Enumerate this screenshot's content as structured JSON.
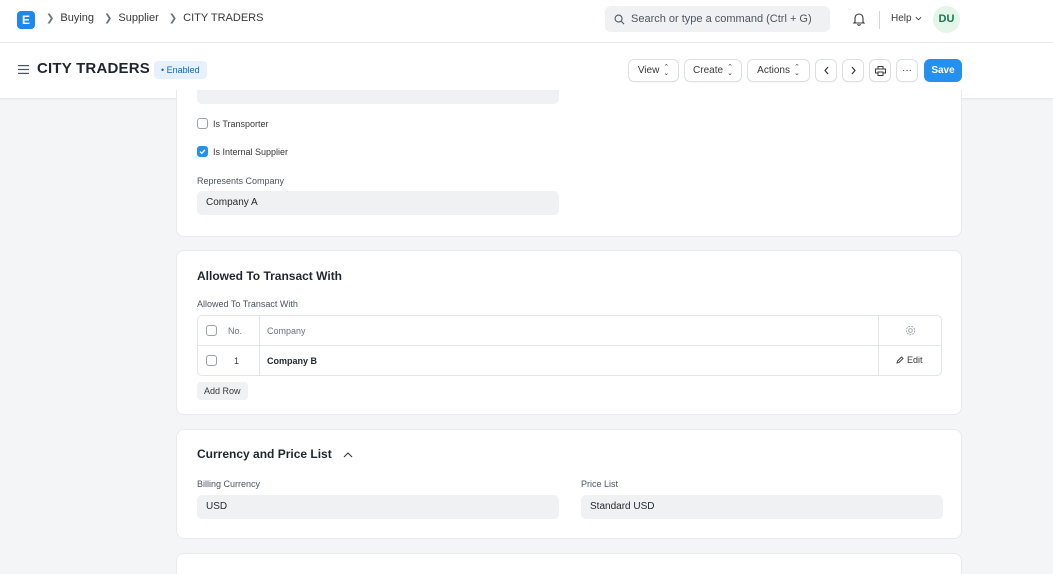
{
  "navbar": {
    "logo_letter": "E",
    "breadcrumbs": [
      "Buying",
      "Supplier",
      "CITY TRADERS"
    ],
    "search_placeholder": "Search or type a command (Ctrl + G)",
    "help_label": "Help",
    "avatar_initials": "DU"
  },
  "page": {
    "title": "CITY TRADERS",
    "status_badge": "Enabled",
    "buttons": {
      "view": "View",
      "create": "Create",
      "actions": "Actions",
      "more": "···",
      "save": "Save"
    }
  },
  "form": {
    "is_transporter_label": "Is Transporter",
    "is_transporter_checked": false,
    "is_internal_supplier_label": "Is Internal Supplier",
    "is_internal_supplier_checked": true,
    "represents_company_label": "Represents Company",
    "represents_company_value": "Company A"
  },
  "allowed_section": {
    "title": "Allowed To Transact With",
    "table_label": "Allowed To Transact With",
    "columns": [
      "No.",
      "Company"
    ],
    "rows": [
      {
        "no": "1",
        "company": "Company B",
        "edit": "Edit"
      }
    ],
    "add_row_label": "Add Row"
  },
  "currency_section": {
    "title": "Currency and Price List",
    "billing_currency_label": "Billing Currency",
    "billing_currency_value": "USD",
    "price_list_label": "Price List",
    "price_list_value": "Standard USD"
  },
  "colors": {
    "primary": "#2490ef",
    "badge_bg": "#e6f1fd",
    "badge_text": "#1366b5"
  }
}
